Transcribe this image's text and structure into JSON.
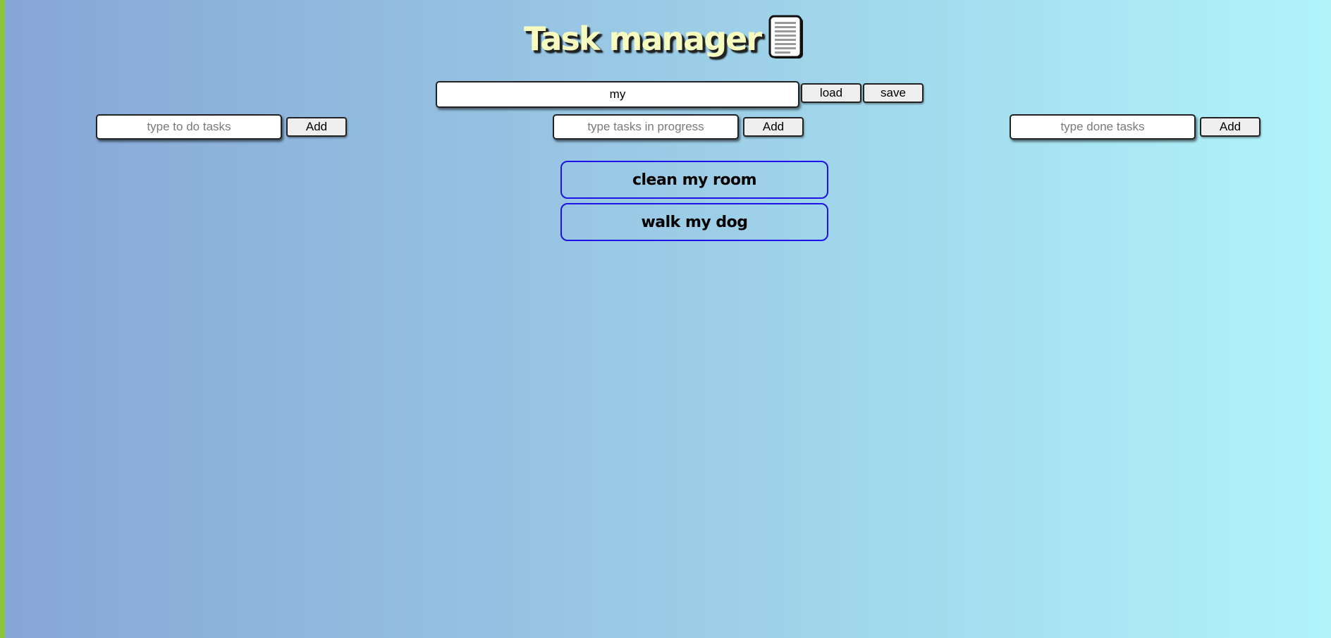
{
  "header": {
    "title": "Task manager",
    "icon": "scroll-document-icon"
  },
  "storage": {
    "value": "my",
    "load_label": "load",
    "save_label": "save"
  },
  "columns": [
    {
      "placeholder": "type to do tasks",
      "add_label": "Add"
    },
    {
      "placeholder": "type tasks in progress",
      "add_label": "Add"
    },
    {
      "placeholder": "type done tasks",
      "add_label": "Add"
    }
  ],
  "tasks": [
    {
      "label": "clean my room"
    },
    {
      "label": "walk my dog"
    }
  ],
  "colors": {
    "title": "#f6fbc0",
    "task_border": "#1f12e6",
    "accent_stripe": "#8cc43a"
  }
}
